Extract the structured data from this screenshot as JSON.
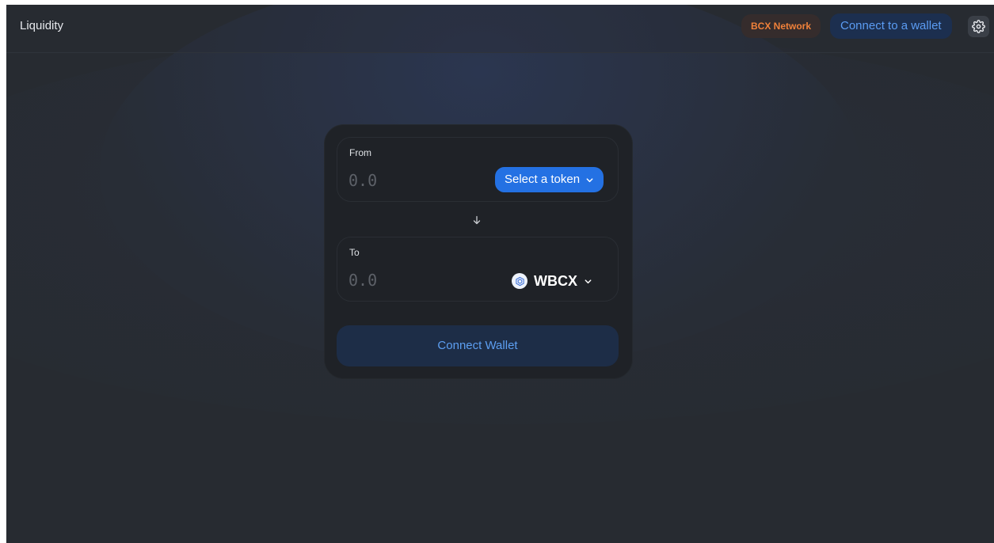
{
  "header": {
    "title": "Liquidity",
    "network_badge": "BCX Network",
    "connect_button": "Connect to a wallet",
    "settings_icon": "gear-icon"
  },
  "swap": {
    "from": {
      "label": "From",
      "amount_placeholder": "0.0",
      "token_button": "Select a token",
      "chevron_icon": "chevron-down-icon"
    },
    "arrow_icon": "arrow-down-icon",
    "to": {
      "label": "To",
      "amount_placeholder": "0.0",
      "token_symbol": "WBCX",
      "token_icon": "wbcx-token-icon",
      "chevron_icon": "chevron-down-icon"
    },
    "connect_wallet_button": "Connect Wallet"
  },
  "colors": {
    "background": "#272b31",
    "card": "#1f2227",
    "accent_blue": "#2471e3",
    "link_blue": "#5b9cf3",
    "network_orange": "#f0813a"
  }
}
